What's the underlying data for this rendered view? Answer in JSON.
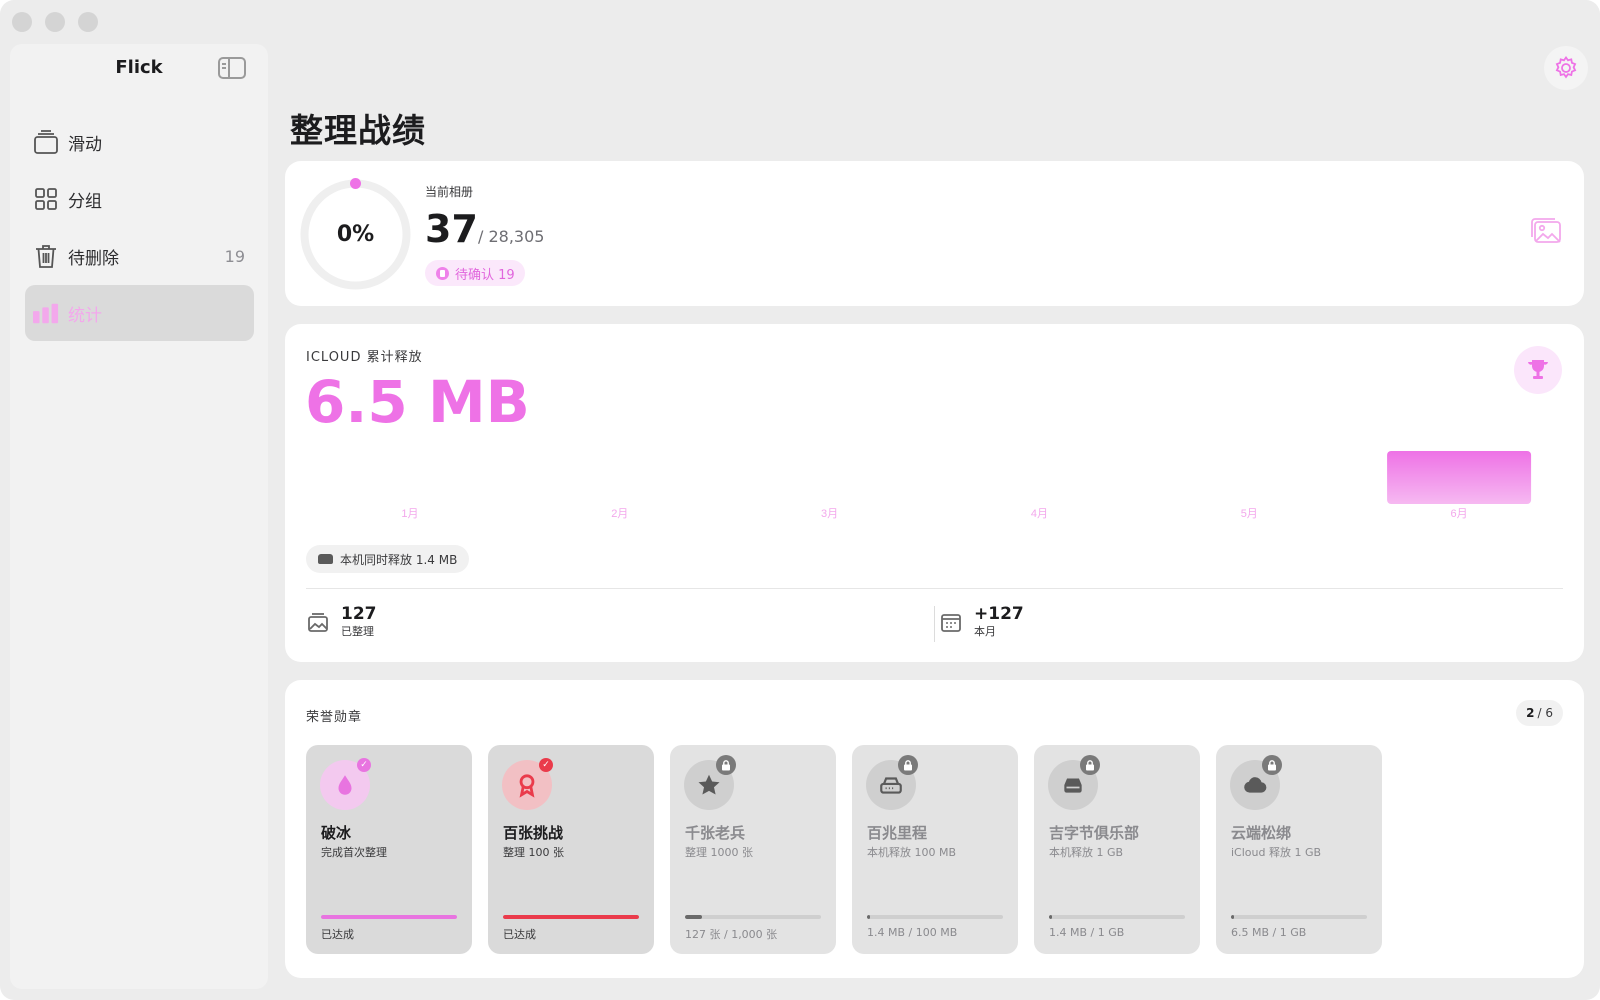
{
  "app": {
    "title": "Flick"
  },
  "sidebar": {
    "items": [
      {
        "label": "滑动",
        "icon": "stack-icon",
        "badge": ""
      },
      {
        "label": "分组",
        "icon": "grid-icon",
        "badge": ""
      },
      {
        "label": "待删除",
        "icon": "trash-icon",
        "badge": "19"
      },
      {
        "label": "统计",
        "icon": "bar-chart-icon",
        "badge": "",
        "active": true
      }
    ]
  },
  "page": {
    "title": "整理战绩"
  },
  "album": {
    "progress_text": "0%",
    "progress_fraction": 0.0,
    "label": "当前相册",
    "count": "37",
    "total": "/ 28,305",
    "pending": "待确认 19"
  },
  "icloud": {
    "label": "ICLOUD 累计释放",
    "amount": "6.5 MB",
    "local_free": "本机同时释放 1.4 MB",
    "stats": [
      {
        "value": "127",
        "label": "已整理",
        "icon": "photo-stack-icon"
      },
      {
        "value": "+127",
        "label": "本月",
        "icon": "calendar-icon"
      }
    ]
  },
  "chart_data": {
    "type": "bar",
    "categories": [
      "1月",
      "2月",
      "3月",
      "4月",
      "5月",
      "6月"
    ],
    "values": [
      0,
      0,
      0,
      0,
      0,
      6.5
    ],
    "title": "",
    "xlabel": "",
    "ylabel": "",
    "ylim": [
      0,
      6.5
    ],
    "grid": false,
    "color": "#ee72e6"
  },
  "honors": {
    "label": "荣誉勋章",
    "unlocked": "2",
    "total_text": "/ 6",
    "badges": [
      {
        "name": "破冰",
        "desc": "完成首次整理",
        "progress_text": "已达成",
        "progress": 1.0,
        "locked": false,
        "icon": "drop-icon",
        "color": "#e874e0",
        "bg": "#f3c9ef"
      },
      {
        "name": "百张挑战",
        "desc": "整理 100 张",
        "progress_text": "已达成",
        "progress": 1.0,
        "locked": false,
        "icon": "ribbon-icon",
        "color": "#ea3b4b",
        "bg": "#f2c0c4"
      },
      {
        "name": "千张老兵",
        "desc": "整理 1000 张",
        "progress_text": "127 张 / 1,000 张",
        "progress": 0.127,
        "locked": true,
        "icon": "star-icon",
        "color": "#5a5a5a",
        "bg": "#cfcfcf"
      },
      {
        "name": "百兆里程",
        "desc": "本机释放 100 MB",
        "progress_text": "1.4 MB / 100 MB",
        "progress": 0.014,
        "locked": true,
        "icon": "drive-icon",
        "color": "#5a5a5a",
        "bg": "#cfcfcf"
      },
      {
        "name": "吉字节俱乐部",
        "desc": "本机释放 1 GB",
        "progress_text": "1.4 MB / 1 GB",
        "progress": 0.0014,
        "locked": true,
        "icon": "disk-icon",
        "color": "#5a5a5a",
        "bg": "#cfcfcf"
      },
      {
        "name": "云端松绑",
        "desc": "iCloud 释放 1 GB",
        "progress_text": "6.5 MB / 1 GB",
        "progress": 0.0065,
        "locked": true,
        "icon": "cloud-icon",
        "color": "#5a5a5a",
        "bg": "#cfcfcf"
      }
    ]
  },
  "colors": {
    "accent": "#ee72e6",
    "accent_light": "#fbe6fb",
    "danger": "#ea3b4b"
  }
}
